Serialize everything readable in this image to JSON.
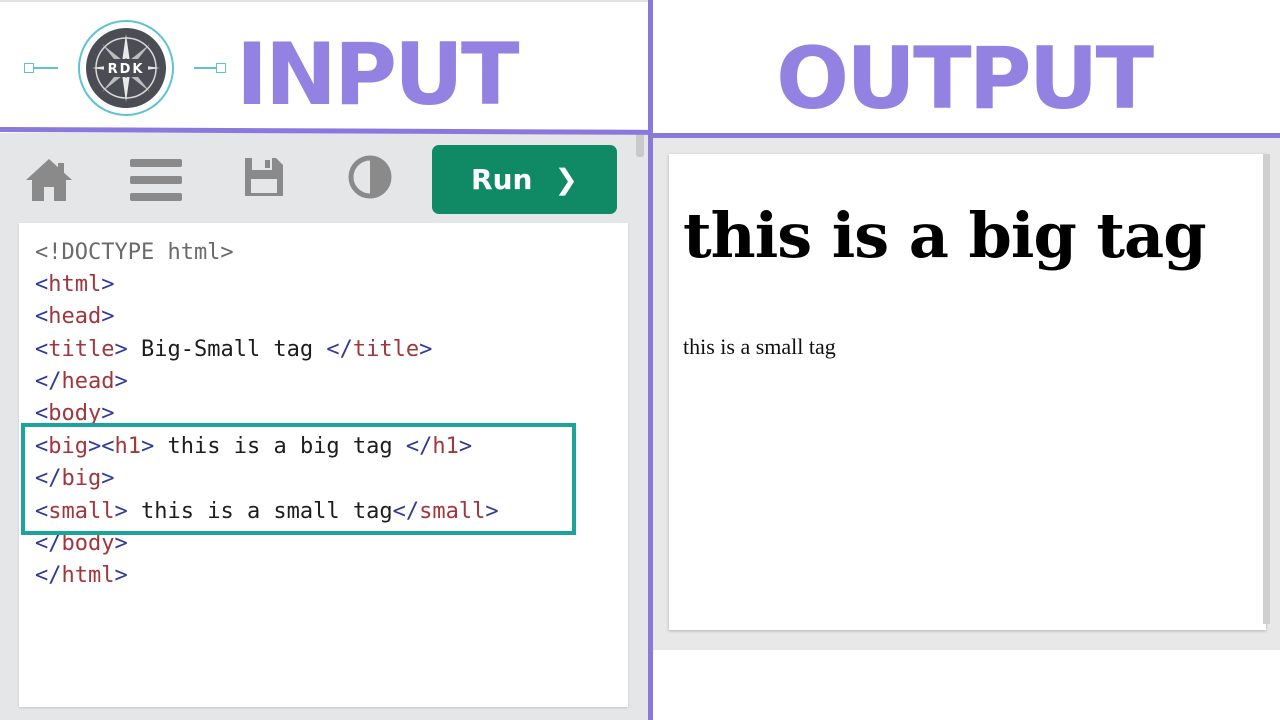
{
  "header": {
    "logo_text": "RDK",
    "input_title": "INPUT",
    "output_title": "OUTPUT"
  },
  "toolbar": {
    "home_icon": "home-icon",
    "menu_icon": "menu-icon",
    "save_icon": "save-icon",
    "theme_icon": "contrast-icon",
    "run_label": "Run",
    "run_chevron": "❯"
  },
  "code": {
    "doctype": "<!DOCTYPE html>",
    "l2_open": "<",
    "l2_tag": "html",
    "l2_close": ">",
    "l3_open": "<",
    "l3_tag": "head",
    "l3_close": ">",
    "l4_open": "<",
    "l4_tag": "title",
    "l4_close": ">",
    "l4_text": " Big-Small tag ",
    "l4_end_open": "</",
    "l4_end_tag": "title",
    "l4_end_close": ">",
    "l5_open": "</",
    "l5_tag": "head",
    "l5_close": ">",
    "l6_open": "<",
    "l6_tag": "body",
    "l6_close": ">",
    "l7_a_open": "<",
    "l7_a_tag": "big",
    "l7_a_close": ">",
    "l7_b_open": "<",
    "l7_b_tag": "h1",
    "l7_b_close": ">",
    "l7_text": " this is a big tag ",
    "l7_end_open": "</",
    "l7_end_tag": "h1",
    "l7_end_close": ">",
    "l8_open": "</",
    "l8_tag": "big",
    "l8_close": ">",
    "l9_open": "<",
    "l9_tag": "small",
    "l9_close": ">",
    "l9_text": " this is a small tag",
    "l9_end_open": "</",
    "l9_end_tag": "small",
    "l9_end_close": ">",
    "l10_open": "</",
    "l10_tag": "body",
    "l10_close": ">",
    "l11_open": "</",
    "l11_tag": "html",
    "l11_close": ">"
  },
  "output": {
    "big_text": "this is a big tag",
    "small_text": "this is a small tag"
  },
  "colors": {
    "accent_purple": "#8a78dd",
    "run_green": "#0f8a65",
    "highlight_teal": "#1ba39c"
  }
}
